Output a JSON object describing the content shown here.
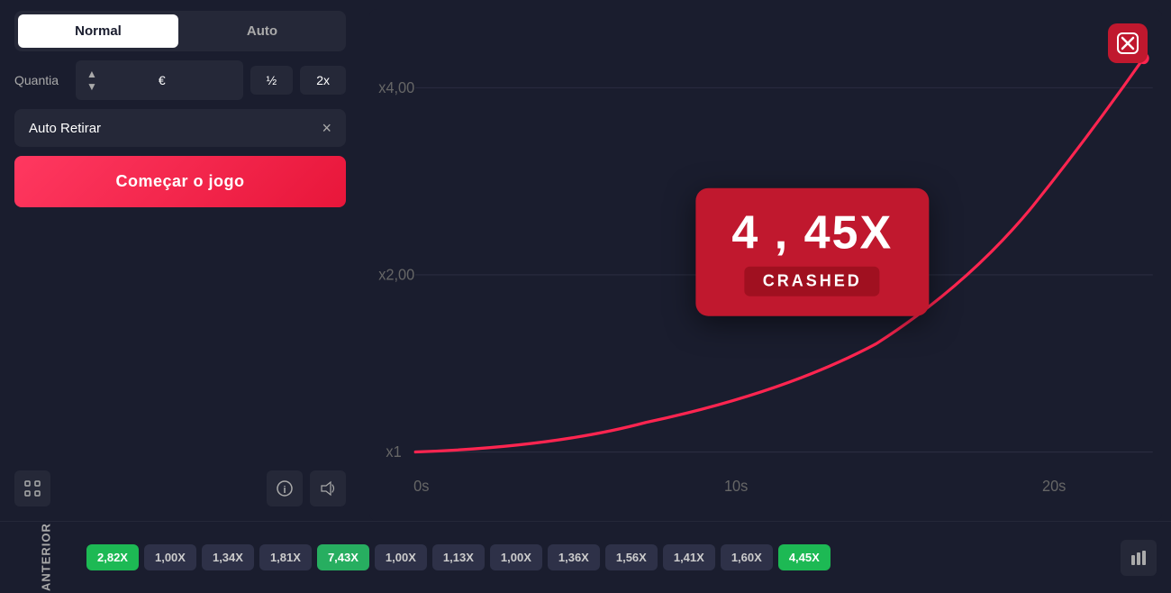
{
  "tabs": {
    "normal": "Normal",
    "auto": "Auto"
  },
  "quantidade": {
    "label": "Quantia",
    "value": "",
    "symbol": "€",
    "half": "½",
    "double": "2x"
  },
  "autoRetirar": {
    "label": "Auto Retirar",
    "closeIcon": "×"
  },
  "comecar": {
    "label": "Começar o jogo"
  },
  "chart": {
    "yLabels": [
      "x4,00",
      "x2,00",
      "x1"
    ],
    "xLabels": [
      "0s",
      "10s",
      "20s"
    ],
    "crashedMultiplier": "4 , 45X",
    "crashedLabel": "CRASHED"
  },
  "anterior": {
    "label": "ANTERIOR",
    "chips": [
      {
        "value": "2,82X",
        "type": "green"
      },
      {
        "value": "1,00X",
        "type": "gray"
      },
      {
        "value": "1,34X",
        "type": "gray"
      },
      {
        "value": "1,81X",
        "type": "gray"
      },
      {
        "value": "7,43X",
        "type": "green-mid"
      },
      {
        "value": "1,00X",
        "type": "gray"
      },
      {
        "value": "1,13X",
        "type": "gray"
      },
      {
        "value": "1,00X",
        "type": "gray"
      },
      {
        "value": "1,36X",
        "type": "gray"
      },
      {
        "value": "1,56X",
        "type": "gray"
      },
      {
        "value": "1,41X",
        "type": "gray"
      },
      {
        "value": "1,60X",
        "type": "gray"
      },
      {
        "value": "4,45X",
        "type": "green"
      }
    ]
  },
  "icons": {
    "fullscreen": "⛶",
    "info": "ⓘ",
    "sound": "🔊",
    "chartBars": "▐▌"
  }
}
